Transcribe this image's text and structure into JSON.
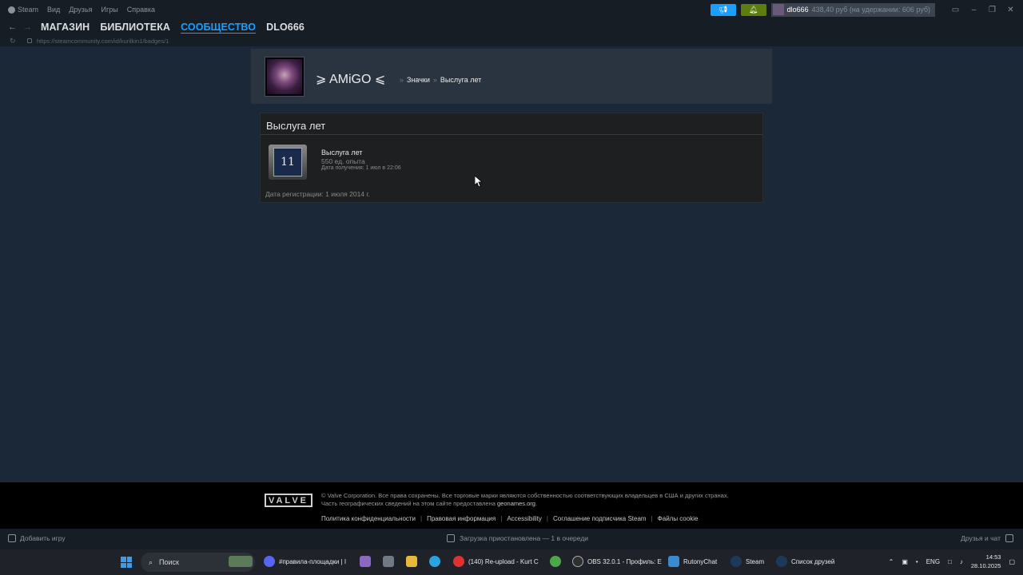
{
  "titlebar": {
    "menu": [
      "Steam",
      "Вид",
      "Друзья",
      "Игры",
      "Справка"
    ],
    "account_name": "dlo666",
    "balance": "438,40 руб (на удержании: 606 руб)"
  },
  "nav": {
    "tabs": [
      "МАГАЗИН",
      "БИБЛИОТЕКА",
      "СООБЩЕСТВО",
      "DLO666"
    ],
    "active_tab": "СООБЩЕСТВО"
  },
  "url": "https://steamcommunity.com/id/kurilkin1/badges/1",
  "profile": {
    "name": "⩾ AMiGO ⩽",
    "crumb_1": "Значки",
    "crumb_2": "Выслуга лет",
    "crumb_sep": "»"
  },
  "badge": {
    "panel_title": "Выслуга лет",
    "icon_number": "11",
    "name": "Выслуга лет",
    "xp": "550 ед. опыта",
    "earned": "Дата получения: 1 июл в 22:06",
    "registration": "Дата регистрации: 1 июля 2014 г."
  },
  "footer": {
    "logo": "VALVE",
    "legal_line1": "© Valve Corporation. Все права сохранены. Все торговые марки являются собственностью соответствующих владельцев в США и других странах.",
    "legal_line2": "Часть географических сведений на этом сайте предоставлена",
    "legal_link": "geonames.org",
    "legal_end": ".",
    "links": [
      "Политика конфиденциальности",
      "Правовая информация",
      "Accessibility",
      "Соглашение подписчика Steam",
      "Файлы cookie"
    ],
    "link_sep": "|"
  },
  "statusbar": {
    "add_game": "Добавить игру",
    "downloads": "Загрузка приостановлена — 1 в очереди",
    "friends": "Друзья и чат"
  },
  "taskbar": {
    "search": "Поиск",
    "apps": [
      "#правила-площадки | I",
      "(140) Re-upload - Kurt C",
      "OBS 32.0.1 - Профиль: E",
      "RutonyChat",
      "Steam",
      "Список друзей"
    ],
    "lang": "ENG",
    "time": "14:53",
    "date": "28.10.2025"
  },
  "colors": {
    "accent": "#1a9fff",
    "background": "#1b2838",
    "notification_green": "#5c7e10"
  }
}
